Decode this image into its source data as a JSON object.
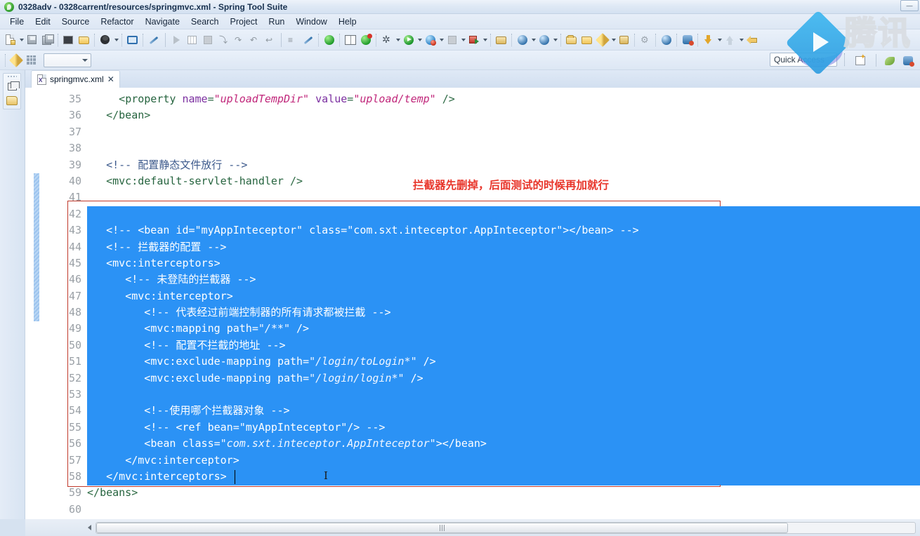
{
  "window": {
    "title": "0328adv - 0328carrent/resources/springmvc.xml - Spring Tool Suite",
    "app_icon": "spring-leaf-icon",
    "minimize_label": "—",
    "maximize_label": "▢",
    "close_label": "✕"
  },
  "menu": {
    "items": [
      {
        "label": "File",
        "name": "menu-file"
      },
      {
        "label": "Edit",
        "name": "menu-edit"
      },
      {
        "label": "Source",
        "name": "menu-source"
      },
      {
        "label": "Refactor",
        "name": "menu-refactor"
      },
      {
        "label": "Navigate",
        "name": "menu-navigate"
      },
      {
        "label": "Search",
        "name": "menu-search"
      },
      {
        "label": "Project",
        "name": "menu-project"
      },
      {
        "label": "Run",
        "name": "menu-run"
      },
      {
        "label": "Window",
        "name": "menu-window"
      },
      {
        "label": "Help",
        "name": "menu-help"
      }
    ]
  },
  "toolbar": {
    "quick_access_placeholder": "Quick Access",
    "combo_value": ""
  },
  "editor_tab": {
    "filename": "springmvc.xml",
    "close_glyph": "✕",
    "file_icon": "xml-file-icon"
  },
  "annotation": {
    "text": "拦截器先删掉，后面测试的时候再加就行",
    "color": "#e8352a"
  },
  "colors": {
    "selection_blue": "#2b92f5",
    "red_box": "#c0392b",
    "tag_green": "#26643f",
    "attr_purple": "#7b2fa0",
    "value_pink": "#c0267a",
    "comment_blue": "#3d5a8c"
  },
  "watermark": {
    "text": "腾讯",
    "play_icon": "play-triangle-icon"
  },
  "code": {
    "first_line": 35,
    "selection_start_line": 42,
    "selection_end_line": 58,
    "lines": [
      {
        "n": 35,
        "indent": 5,
        "selected": false,
        "tokens": [
          {
            "t": "punct",
            "v": "<"
          },
          {
            "t": "tag",
            "v": "property"
          },
          {
            "t": "plain",
            "v": " "
          },
          {
            "t": "attr",
            "v": "name"
          },
          {
            "t": "punct",
            "v": "="
          },
          {
            "t": "val",
            "v": "\"uploadTempDir\""
          },
          {
            "t": "plain",
            "v": " "
          },
          {
            "t": "attr",
            "v": "value"
          },
          {
            "t": "punct",
            "v": "="
          },
          {
            "t": "val",
            "v": "\"upload/temp\""
          },
          {
            "t": "plain",
            "v": " "
          },
          {
            "t": "punct",
            "v": "/>"
          }
        ]
      },
      {
        "n": 36,
        "indent": 3,
        "selected": false,
        "tokens": [
          {
            "t": "punct",
            "v": "</"
          },
          {
            "t": "tag",
            "v": "bean"
          },
          {
            "t": "punct",
            "v": ">"
          }
        ]
      },
      {
        "n": 37,
        "indent": 0,
        "selected": false,
        "tokens": []
      },
      {
        "n": 38,
        "indent": 0,
        "selected": false,
        "tokens": []
      },
      {
        "n": 39,
        "indent": 3,
        "selected": false,
        "tokens": [
          {
            "t": "cmt",
            "v": "<!-- 配置静态文件放行 -->"
          }
        ]
      },
      {
        "n": 40,
        "indent": 3,
        "selected": false,
        "tokens": [
          {
            "t": "punct",
            "v": "<"
          },
          {
            "t": "tag",
            "v": "mvc:default-servlet-handler"
          },
          {
            "t": "plain",
            "v": " "
          },
          {
            "t": "punct",
            "v": "/>"
          }
        ]
      },
      {
        "n": 41,
        "indent": 0,
        "selected": false,
        "tokens": []
      },
      {
        "n": 42,
        "indent": 0,
        "selected": true,
        "tokens": []
      },
      {
        "n": 43,
        "indent": 3,
        "selected": true,
        "tokens": [
          {
            "t": "cmt",
            "v": "<!-- <bean id=\"myAppInteceptor\" class=\"com.sxt.inteceptor.AppInteceptor\"></bean> -->"
          }
        ]
      },
      {
        "n": 44,
        "indent": 3,
        "selected": true,
        "tokens": [
          {
            "t": "cmt",
            "v": "<!-- 拦截器的配置 -->"
          }
        ]
      },
      {
        "n": 45,
        "indent": 3,
        "selected": true,
        "tokens": [
          {
            "t": "punct",
            "v": "<"
          },
          {
            "t": "tag",
            "v": "mvc:interceptors"
          },
          {
            "t": "punct",
            "v": ">"
          }
        ]
      },
      {
        "n": 46,
        "indent": 6,
        "selected": true,
        "tokens": [
          {
            "t": "cmt",
            "v": "<!-- 未登陆的拦截器 -->"
          }
        ]
      },
      {
        "n": 47,
        "indent": 6,
        "selected": true,
        "tokens": [
          {
            "t": "punct",
            "v": "<"
          },
          {
            "t": "tag",
            "v": "mvc:interceptor"
          },
          {
            "t": "punct",
            "v": ">"
          }
        ]
      },
      {
        "n": 48,
        "indent": 9,
        "selected": true,
        "tokens": [
          {
            "t": "cmt",
            "v": "<!-- 代表经过前端控制器的所有请求都被拦截 -->"
          }
        ]
      },
      {
        "n": 49,
        "indent": 9,
        "selected": true,
        "tokens": [
          {
            "t": "punct",
            "v": "<"
          },
          {
            "t": "tag",
            "v": "mvc:mapping"
          },
          {
            "t": "plain",
            "v": " "
          },
          {
            "t": "attr",
            "v": "path"
          },
          {
            "t": "punct",
            "v": "="
          },
          {
            "t": "val",
            "v": "\"/**\""
          },
          {
            "t": "plain",
            "v": " "
          },
          {
            "t": "punct",
            "v": "/>"
          }
        ]
      },
      {
        "n": 50,
        "indent": 9,
        "selected": true,
        "tokens": [
          {
            "t": "cmt",
            "v": "<!-- 配置不拦截的地址 -->"
          }
        ]
      },
      {
        "n": 51,
        "indent": 9,
        "selected": true,
        "tokens": [
          {
            "t": "punct",
            "v": "<"
          },
          {
            "t": "tag",
            "v": "mvc:exclude-mapping"
          },
          {
            "t": "plain",
            "v": " "
          },
          {
            "t": "attr",
            "v": "path"
          },
          {
            "t": "punct",
            "v": "="
          },
          {
            "t": "val",
            "v": "\"/login/toLogin*\""
          },
          {
            "t": "plain",
            "v": " "
          },
          {
            "t": "punct",
            "v": "/>"
          }
        ]
      },
      {
        "n": 52,
        "indent": 9,
        "selected": true,
        "tokens": [
          {
            "t": "punct",
            "v": "<"
          },
          {
            "t": "tag",
            "v": "mvc:exclude-mapping"
          },
          {
            "t": "plain",
            "v": " "
          },
          {
            "t": "attr",
            "v": "path"
          },
          {
            "t": "punct",
            "v": "="
          },
          {
            "t": "val",
            "v": "\"/login/login*\""
          },
          {
            "t": "plain",
            "v": " "
          },
          {
            "t": "punct",
            "v": "/>"
          }
        ]
      },
      {
        "n": 53,
        "indent": 0,
        "selected": true,
        "tokens": []
      },
      {
        "n": 54,
        "indent": 9,
        "selected": true,
        "tokens": [
          {
            "t": "cmt",
            "v": "<!--使用哪个拦截器对象 -->"
          }
        ]
      },
      {
        "n": 55,
        "indent": 9,
        "selected": true,
        "tokens": [
          {
            "t": "cmt",
            "v": "<!-- <ref bean=\"myAppInteceptor\"/> -->"
          }
        ]
      },
      {
        "n": 56,
        "indent": 9,
        "selected": true,
        "tokens": [
          {
            "t": "punct",
            "v": "<"
          },
          {
            "t": "tag",
            "v": "bean"
          },
          {
            "t": "plain",
            "v": " "
          },
          {
            "t": "attr",
            "v": "class"
          },
          {
            "t": "punct",
            "v": "="
          },
          {
            "t": "val",
            "v": "\"com.sxt.inteceptor.AppInteceptor\""
          },
          {
            "t": "punct",
            "v": "></"
          },
          {
            "t": "tag",
            "v": "bean"
          },
          {
            "t": "punct",
            "v": ">"
          }
        ]
      },
      {
        "n": 57,
        "indent": 6,
        "selected": true,
        "tokens": [
          {
            "t": "punct",
            "v": "</"
          },
          {
            "t": "tag",
            "v": "mvc:interceptor"
          },
          {
            "t": "punct",
            "v": ">"
          }
        ]
      },
      {
        "n": 58,
        "indent": 3,
        "selected": true,
        "tokens": [
          {
            "t": "punct",
            "v": "</"
          },
          {
            "t": "tag",
            "v": "mvc:interceptors"
          },
          {
            "t": "punct",
            "v": ">"
          }
        ]
      },
      {
        "n": 59,
        "indent": 0,
        "selected": false,
        "tokens": [
          {
            "t": "punct",
            "v": "</"
          },
          {
            "t": "tag",
            "v": "beans"
          },
          {
            "t": "punct",
            "v": ">"
          }
        ]
      },
      {
        "n": 60,
        "indent": 0,
        "selected": false,
        "tokens": []
      }
    ]
  },
  "scrollbar": {
    "left_arrow_glyph": "◀",
    "thumb_grip": "grip"
  }
}
